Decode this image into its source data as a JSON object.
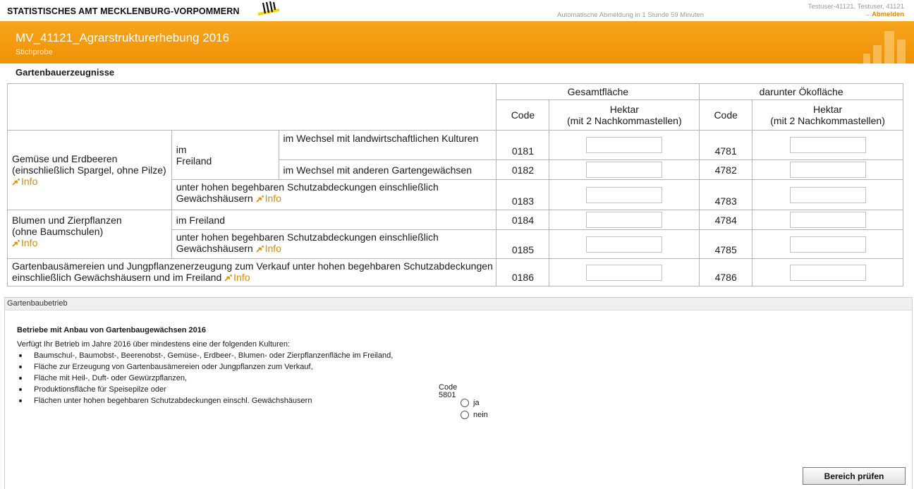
{
  "topbar": {
    "brand": "STATISTISCHES AMT MECKLENBURG-VORPOMMERN",
    "brand_logo_icon": "mv-crest-logo-icon",
    "auto_logout": "Automatische Abmeldung in 1 Stunde 59 Minuten",
    "user": "Testuser-41121, Testuser, 41121",
    "logout": "→ Abmelden"
  },
  "header": {
    "title": "MV_41121_Agrarstrukturerhebung 2016",
    "subtitle": "Stichprobe",
    "background_color": "#f49a10"
  },
  "section": {
    "title": "Gartenbauerzeugnisse"
  },
  "table": {
    "group_headers": [
      "Gesamtfläche",
      "darunter Ökofläche"
    ],
    "code_header": "Code",
    "hektar_header_line1": "Hektar",
    "hektar_header_line2": "(mit 2 Nachkommastellen)",
    "info_label": "Info",
    "gemuese_label": "Gemüse und Erdbeeren (einschließlich Spargel, ohne Pilze)",
    "im_freiland_label_line1": "im",
    "im_freiland_label_line2": "Freiland",
    "blumen_label_line1": "Blumen und Zierpflanzen",
    "blumen_label_line2": "(ohne Baumschulen)",
    "rows": [
      {
        "label": "im Wechsel mit landwirtschaftlichen Kulturen",
        "code1": "0181",
        "value1": "",
        "code2": "4781",
        "value2": ""
      },
      {
        "label": "im Wechsel mit anderen Gartengewächsen",
        "code1": "0182",
        "value1": "",
        "code2": "4782",
        "value2": ""
      },
      {
        "label": "unter hohen begehbaren Schutzabdeckungen einschließlich Gewächshäusern",
        "code1": "0183",
        "value1": "",
        "code2": "4783",
        "value2": ""
      },
      {
        "label": "im Freiland",
        "code1": "0184",
        "value1": "",
        "code2": "4784",
        "value2": ""
      },
      {
        "label": "unter hohen begehbaren Schutzabdeckungen einschließlich Gewächshäusern",
        "code1": "0185",
        "value1": "",
        "code2": "4785",
        "value2": ""
      },
      {
        "label": "Gartenbausämereien und Jungpflanzenerzeugung zum Verkauf unter hohen begehbaren Schutzabdeckungen einschließlich Gewächshäusern und im Freiland",
        "code1": "0186",
        "value1": "",
        "code2": "4786",
        "value2": ""
      }
    ],
    "link_color": "#e08a00"
  },
  "panel": {
    "title": "Gartenbaubetrieb",
    "question_title": "Betriebe mit Anbau von Gartenbaugewächsen 2016",
    "question_intro": "Verfügt Ihr Betrieb im Jahre 2016 über mindestens eine der folgenden Kulturen:",
    "items": [
      "Baumschul-, Baumobst-, Beerenobst-, Gemüse-, Erdbeer-, Blumen- oder Zierpflanzenfläche im Freiland,",
      "Fläche zur Erzeugung von Gartenbausämereien oder Jungpflanzen zum Verkauf,",
      "Fläche mit Heil-, Duft- oder Gewürzpflanzen,",
      "Produktionsfläche für Speisepilze oder",
      "Flächen unter hohen begehbaren Schutzabdeckungen  einschl. Gewächshäusern"
    ],
    "code_label": "Code",
    "code_value": "5801",
    "option_yes": "ja",
    "option_no": "nein",
    "selected": "",
    "check_button": "Bereich prüfen"
  }
}
